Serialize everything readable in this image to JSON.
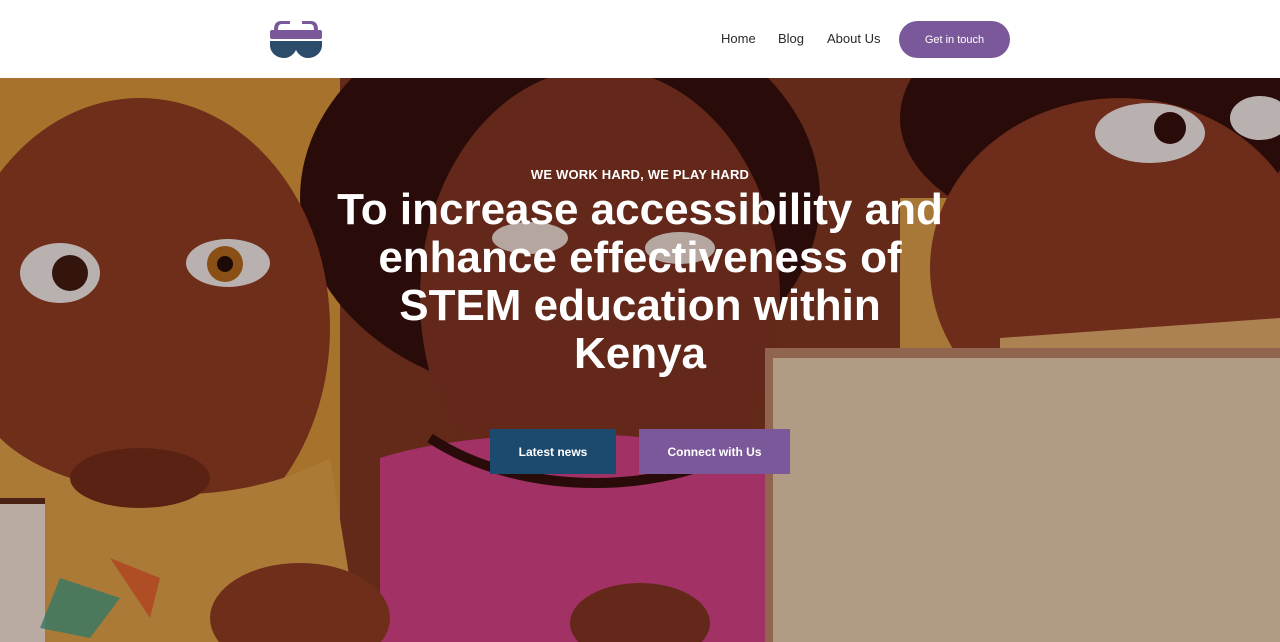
{
  "header": {
    "logo_icon": "goggles-logo-icon",
    "nav": [
      {
        "label": "Home"
      },
      {
        "label": "Blog"
      },
      {
        "label": "About Us"
      }
    ],
    "cta_label": "Get in touch"
  },
  "hero": {
    "eyebrow": "WE WORK HARD, WE PLAY HARD",
    "headline": "To increase accessibility and enhance effectiveness of STEM education within Kenya",
    "buttons": {
      "news_label": "Latest news",
      "connect_label": "Connect with Us"
    },
    "background": "illustration of children"
  },
  "colors": {
    "accent_purple": "#7b5899",
    "navy": "#1c4a6e",
    "logo_navy": "#2c4c6c"
  }
}
